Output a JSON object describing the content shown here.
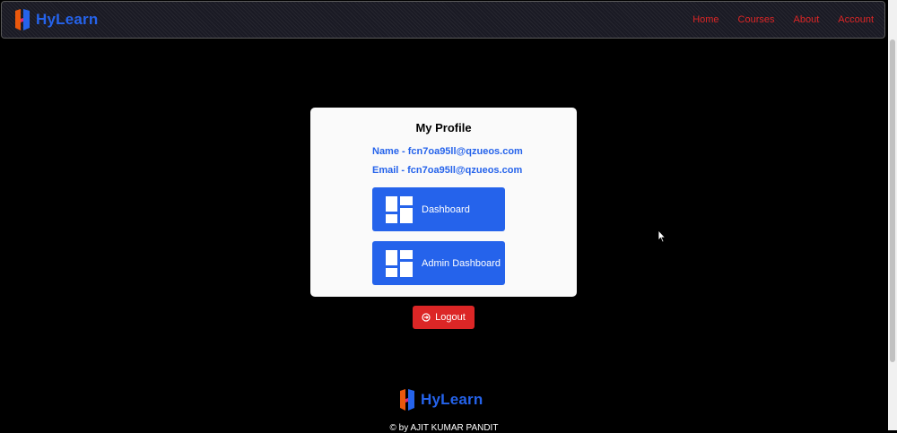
{
  "header": {
    "brand": "HyLearn",
    "nav": [
      "Home",
      "Courses",
      "About",
      "Account"
    ]
  },
  "profile": {
    "title": "My Profile",
    "name": "Name - fcn7oa95ll@qzueos.com",
    "email": "Email - fcn7oa95ll@qzueos.com",
    "dashboard_label": "Dashboard",
    "admin_dashboard_label": "Admin Dashboard"
  },
  "logout_label": "Logout",
  "footer": {
    "brand": "HyLearn",
    "credit": "© by AJIT KUMAR PANDIT"
  },
  "colors": {
    "accent": "#2563eb",
    "danger": "#dc2626"
  },
  "icons": [
    "hylearn-logo-icon",
    "dashboard-icon",
    "logout-icon",
    "mouse-cursor-icon"
  ]
}
